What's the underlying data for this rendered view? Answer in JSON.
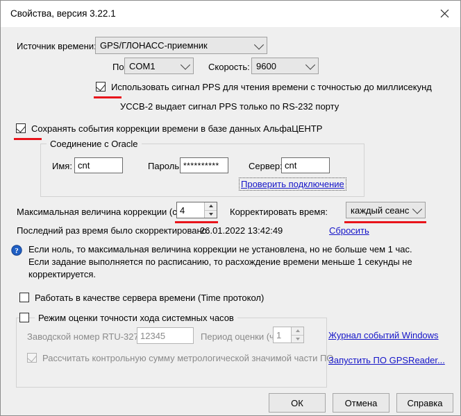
{
  "window": {
    "title": "Свойства, версия 3.22.1",
    "close_icon": "close-icon"
  },
  "time_source": {
    "label": "Источник времени:",
    "value": "GPS/ГЛОНАСС-приемник"
  },
  "port": {
    "label": "Порт:",
    "value": "COM1"
  },
  "speed": {
    "label": "Скорость:",
    "value": "9600"
  },
  "pps": {
    "checkbox_label": "Использовать сигнал PPS  для чтения  времени с точностью до миллисекунд",
    "checked": true,
    "note": "УССВ-2 выдает сигнал PPS только по RS-232 порту"
  },
  "save_events": {
    "checkbox_label": "Сохранять события коррекции времени  в базе данных АльфаЦЕНТР",
    "checked": true
  },
  "oracle": {
    "group_title": "Соединение с Oracle",
    "name_label": "Имя:",
    "name_value": "cnt",
    "password_label": "Пароль:",
    "password_value": "**********",
    "server_label": "Сервер:",
    "server_value": "cnt",
    "test_link": "Проверить подключение"
  },
  "correction": {
    "max_label": "Максимальная величина коррекции (с):",
    "max_value": "4",
    "mode_label": "Корректировать время:",
    "mode_value": "каждый сеанс",
    "last_label": "Последний раз время было скорректировано:",
    "last_value": "26.01.2022 13:42:49",
    "reset_link": "Сбросить"
  },
  "info": {
    "icon": "help-icon",
    "line1": "Если ноль, то максимальная величина коррекции не установлена, но не больше чем 1 час.",
    "line2": "Если задание выполняется по расписанию, то расхождение времени меньше 1 секунды не",
    "line3": "корректируется."
  },
  "time_server": {
    "checkbox_label": "Работать в качестве сервера времени (Time протокол)",
    "checked": false
  },
  "accuracy_mode": {
    "checkbox_label": "Режим оценки точности хода системных часов",
    "checked": false,
    "serial_label": "Заводской номер RTU-327:",
    "serial_value": "12345",
    "period_label": "Период оценки (ч.):",
    "period_value": "1",
    "checksum_label": "Рассчитать контрольную сумму метрологической значимой части ПО",
    "checksum_checked": true
  },
  "side_links": {
    "event_log": "Журнал событий Windows",
    "gpsreader": "Запустить ПО GPSReader..."
  },
  "buttons": {
    "ok": "ОК",
    "cancel": "Отмена",
    "help": "Справка"
  },
  "colors": {
    "annotation_red": "#e8131a",
    "link_blue": "#1313c8",
    "dialog_bg": "#efefef",
    "titlebar_bg": "#ffffff"
  }
}
